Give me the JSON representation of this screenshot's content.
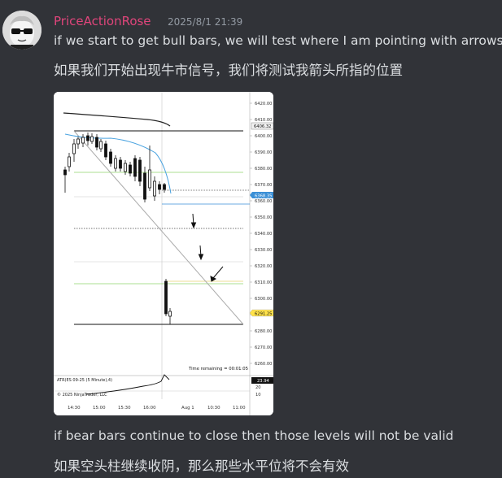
{
  "author": {
    "name": "PriceActionRose",
    "timestamp": "2025/8/1 21:39"
  },
  "messages": [
    {
      "text": "if we start to get bull bars, we will test where I am pointing with arrows"
    },
    {
      "text": "如果我们开始出现牛市信号，我们将测试我箭头所指的位置"
    },
    {
      "text": "if bear bars continue to close then those levels will not be valid"
    },
    {
      "text": "如果空头柱继续收阴，那么那些水平位将不会有效"
    }
  ],
  "attachment": {
    "price_axis": [
      "6420.00",
      "6410.00",
      "6400.00",
      "6390.00",
      "6380.00",
      "6370.00",
      "6360.00",
      "6350.00",
      "6340.00",
      "6330.00",
      "6320.00",
      "6310.00",
      "6300.00",
      "6290.00",
      "6280.00",
      "6270.00",
      "6260.00"
    ],
    "price_markers": {
      "top": "6406.32",
      "current": "6368.35",
      "low": "6291.25"
    },
    "time_remaining": "Time remaining = 00:01:05",
    "indicator_label": "ATR(ES 09-25 (5 Minute),4)",
    "indicator_value": "23.94",
    "indicator_axis": [
      "20",
      "10"
    ],
    "copyright": "© 2025 NinjaTrader, LLC",
    "time_axis": [
      "14:30",
      "15:00",
      "15:30",
      "16:00",
      "Aug 1",
      "10:30",
      "11:00"
    ]
  }
}
